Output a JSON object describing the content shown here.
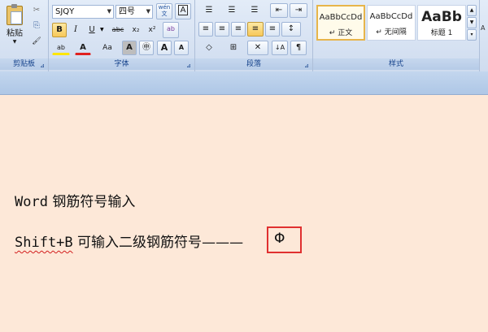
{
  "clipboard": {
    "paste_label": "粘贴",
    "group_label": "剪贴板",
    "cut_icon": "✂",
    "copy_icon": "⎘",
    "format_painter_icon": "🖌"
  },
  "font": {
    "font_name": "SJQY",
    "font_size": "四号",
    "phonetic_label": "wén\n文",
    "border_label": "A",
    "bold": "B",
    "italic": "I",
    "underline": "U",
    "strike": "abc",
    "sub": "x₂",
    "sup": "x²",
    "clear": "ab",
    "highlight": "ab",
    "color": "A",
    "case": "Aa",
    "shading": "A",
    "enclose": "㊥",
    "grow": "A",
    "shrink": "A",
    "group_label": "字体"
  },
  "paragraph": {
    "group_label": "段落",
    "bullets": "☰",
    "numbering": "☰",
    "multilevel": "☰",
    "decrease_indent": "⇤",
    "increase_indent": "⇥",
    "align_left": "≡",
    "center": "≡",
    "align_right": "≡",
    "justify": "≡",
    "distribute": "≡",
    "line_spacing": "↕",
    "sort": "↓A",
    "show_marks": "¶",
    "shading": "◇",
    "borders": "⊞",
    "asian_layout": "✕"
  },
  "styles": {
    "group_label": "样式",
    "items": [
      {
        "preview": "AaBbCcDd",
        "name": "↵ 正文"
      },
      {
        "preview": "AaBbCcDd",
        "name": "↵ 无间隔"
      },
      {
        "preview": "AaBb",
        "name": "标题 1"
      }
    ]
  },
  "document": {
    "line1_latin": "Word",
    "line1_cjk": " 钢筋符号输入",
    "line2_latin": "Shift+B",
    "line2_cjk": " 可输入二级钢筋符号",
    "line2_dashes": "———",
    "symbol": "Φ"
  }
}
